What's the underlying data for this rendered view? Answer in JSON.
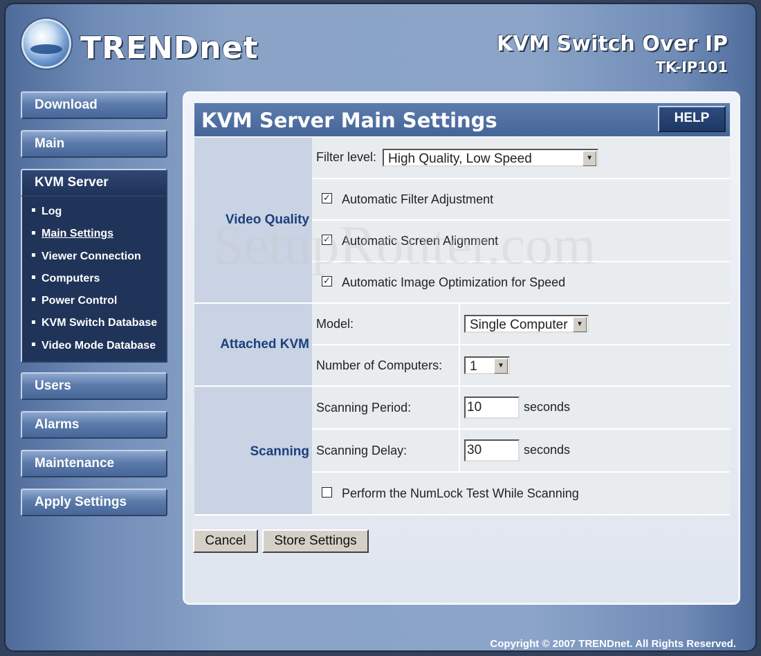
{
  "brand": {
    "logo_text": "TRENDnet",
    "product_name": "KVM Switch Over IP",
    "model": "TK-IP101"
  },
  "nav": {
    "download": "Download",
    "main": "Main",
    "kvm_server": "KVM Server",
    "sub": [
      "Log",
      "Main Settings",
      "Viewer Connection",
      "Computers",
      "Power Control",
      "KVM Switch Database",
      "Video Mode Database"
    ],
    "users": "Users",
    "alarms": "Alarms",
    "maintenance": "Maintenance",
    "apply": "Apply Settings"
  },
  "panel": {
    "title": "KVM Server Main Settings",
    "help": "HELP",
    "video_quality": {
      "section": "Video Quality",
      "filter_label": "Filter level:",
      "filter_value": "High Quality, Low Speed",
      "auto_filter": "Automatic Filter Adjustment",
      "auto_screen": "Automatic Screen Alignment",
      "auto_image": "Automatic Image Optimization for Speed"
    },
    "attached_kvm": {
      "section": "Attached KVM",
      "model_label": "Model:",
      "model_value": "Single Computer",
      "num_label": "Number of Computers:",
      "num_value": "1"
    },
    "scanning": {
      "section": "Scanning",
      "period_label": "Scanning Period:",
      "period_value": "10",
      "delay_label": "Scanning Delay:",
      "delay_value": "30",
      "unit": "seconds",
      "numlock": "Perform the NumLock Test While Scanning"
    },
    "cancel": "Cancel",
    "store": "Store Settings"
  },
  "watermark": "SetupRouter.com",
  "copyright": "Copyright © 2007 TRENDnet. All Rights Reserved."
}
